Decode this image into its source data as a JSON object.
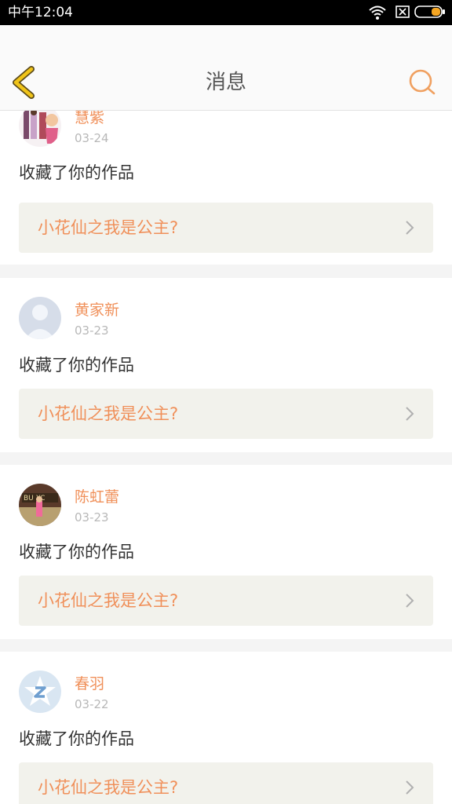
{
  "status_bar": {
    "time": "中午12:04",
    "icons": [
      "wifi-icon",
      "sim-x-icon",
      "battery-icon"
    ],
    "battery_color": "#f5a623"
  },
  "header": {
    "title": "消息",
    "back_icon": "chevron-left-icon",
    "search_icon": "search-icon",
    "back_color": "#f0c419",
    "search_color": "#f0a060"
  },
  "accent_color": "#f0905a",
  "messages": [
    {
      "username": "慧紫",
      "date": "03-24",
      "action": "收藏了你的作品",
      "work_title": "小花仙之我是公主?",
      "avatar": "anime-figures-avatar"
    },
    {
      "username": "黄家新",
      "date": "03-23",
      "action": "收藏了你的作品",
      "work_title": "小花仙之我是公主?",
      "avatar": "default-person-avatar"
    },
    {
      "username": "陈虹蕾",
      "date": "03-23",
      "action": "收藏了你的作品",
      "work_title": "小花仙之我是公主?",
      "avatar": "photo-avatar"
    },
    {
      "username": "春羽",
      "date": "03-22",
      "action": "收藏了你的作品",
      "work_title": "小花仙之我是公主?",
      "avatar": "star-logo-avatar"
    }
  ]
}
